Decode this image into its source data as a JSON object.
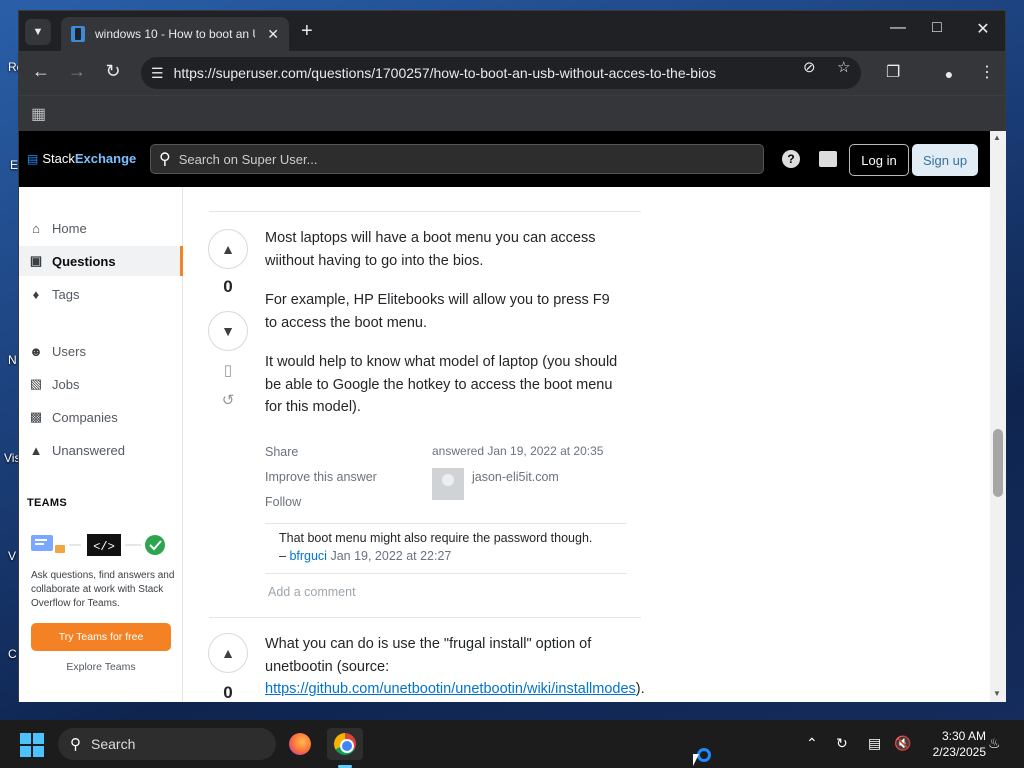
{
  "desktop": {
    "fragments": [
      "Re",
      "E",
      "N",
      "Vis",
      "V",
      "C"
    ]
  },
  "browser": {
    "tab_title": "windows 10 - How to boot an U",
    "url": "https://superuser.com/questions/1700257/how-to-boot-an-usb-without-acces-to-the-bios",
    "icons": {
      "tab_list": "chevron-down-icon",
      "new_tab": "plus-icon",
      "minimize": "minimize-icon",
      "maximize": "maximize-icon",
      "close": "close-icon",
      "back": "back-arrow-icon",
      "forward": "forward-arrow-icon",
      "reload": "reload-icon",
      "site_info": "tune-icon",
      "eye_off": "eye-off-icon",
      "star": "star-icon",
      "extensions": "puzzle-icon",
      "profile": "person-icon",
      "menu": "kebab-menu-icon",
      "apps": "apps-grid-icon"
    }
  },
  "site": {
    "logo_stack": "Stack",
    "logo_exchange": "Exchange",
    "search_placeholder": "Search on Super User...",
    "login_label": "Log in",
    "signup_label": "Sign up",
    "nav": [
      {
        "label": "Home",
        "icon": "home-icon"
      },
      {
        "label": "Questions",
        "icon": "questions-icon",
        "active": true
      },
      {
        "label": "Tags",
        "icon": "tag-icon"
      },
      {
        "label": "Users",
        "icon": "users-icon"
      },
      {
        "label": "Jobs",
        "icon": "briefcase-icon"
      },
      {
        "label": "Companies",
        "icon": "building-icon"
      },
      {
        "label": "Unanswered",
        "icon": "unanswered-icon"
      }
    ],
    "teams": {
      "heading": "TEAMS",
      "description": "Ask questions, find answers and collaborate at work with Stack Overflow for Teams.",
      "try_label": "Try Teams for free",
      "explore_label": "Explore Teams"
    }
  },
  "answers": [
    {
      "votes": "0",
      "paragraphs": [
        "Most laptops will have a boot menu you can access wiithout having to go into the bios.",
        "For example, HP Elitebooks will allow you to press F9 to access the boot menu.",
        "It would help to know what model of laptop (you should be able to Google the hotkey to access the boot menu for this model)."
      ],
      "menu": {
        "share": "Share",
        "improve": "Improve this answer",
        "follow": "Follow"
      },
      "answered": "answered Jan 19, 2022 at 20:35",
      "author": "jason-eli5it.com",
      "comment": {
        "text": "That boot menu might also require the password though.",
        "dash": "–",
        "user": "bfrguci",
        "date": "Jan 19, 2022 at 22:27"
      },
      "add_comment": "Add a comment"
    },
    {
      "votes": "0",
      "text_before": "What you can do is use the \"frugal install\" option of unetbootin (source: ",
      "link": "https://github.com/unetbootin/unetbootin/wiki/installmodes",
      "text_after": "). You can then boot the iso file from the"
    }
  ],
  "taskbar": {
    "search_label": "Search",
    "time": "3:30 AM",
    "date": "2/23/2025",
    "colors": {
      "accent": "#4cc2ff",
      "orange": "#f48225",
      "link": "#0074cc"
    }
  }
}
